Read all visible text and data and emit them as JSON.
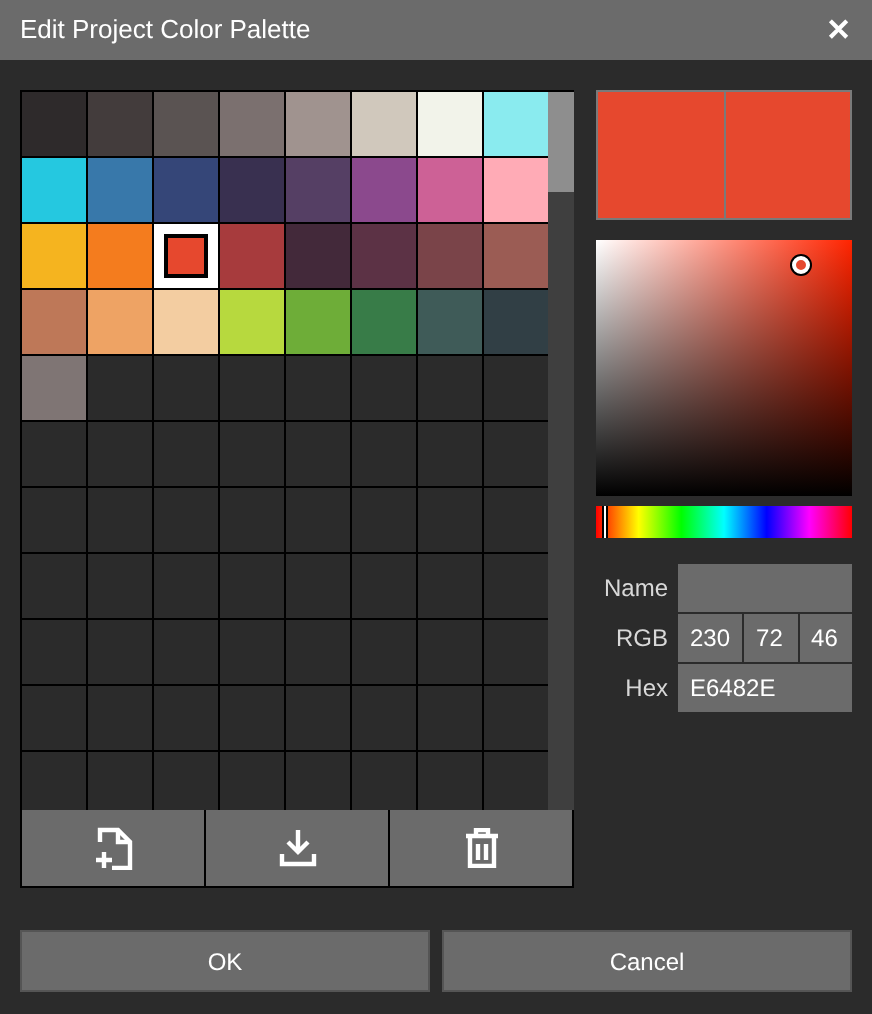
{
  "window": {
    "title": "Edit Project Color Palette",
    "close": "✕"
  },
  "swatches": [
    {
      "color": "#2e2a2b",
      "selected": false
    },
    {
      "color": "#433c3c",
      "selected": false
    },
    {
      "color": "#5a5352",
      "selected": false
    },
    {
      "color": "#7b706f",
      "selected": false
    },
    {
      "color": "#a0938f",
      "selected": false
    },
    {
      "color": "#d0c8bc",
      "selected": false
    },
    {
      "color": "#f2f3ea",
      "selected": false
    },
    {
      "color": "#8aebef",
      "selected": false
    },
    {
      "color": "#25c8e0",
      "selected": false
    },
    {
      "color": "#3878aa",
      "selected": false
    },
    {
      "color": "#354678",
      "selected": false
    },
    {
      "color": "#393050",
      "selected": false
    },
    {
      "color": "#553f64",
      "selected": false
    },
    {
      "color": "#8b498d",
      "selected": false
    },
    {
      "color": "#cd6196",
      "selected": false
    },
    {
      "color": "#ffabb6",
      "selected": false
    },
    {
      "color": "#f5b41f",
      "selected": false
    },
    {
      "color": "#f47c1e",
      "selected": false
    },
    {
      "color": "#e6482e",
      "selected": true
    },
    {
      "color": "#a73b3d",
      "selected": false
    },
    {
      "color": "#43293a",
      "selected": false
    },
    {
      "color": "#5c3245",
      "selected": false
    },
    {
      "color": "#7a4449",
      "selected": false
    },
    {
      "color": "#9b5c54",
      "selected": false
    },
    {
      "color": "#be7858",
      "selected": false
    },
    {
      "color": "#eea364",
      "selected": false
    },
    {
      "color": "#f3cda1",
      "selected": false
    },
    {
      "color": "#b7d93e",
      "selected": false
    },
    {
      "color": "#6ead38",
      "selected": false
    },
    {
      "color": "#387c48",
      "selected": false
    },
    {
      "color": "#3f5b58",
      "selected": false
    },
    {
      "color": "#313f45",
      "selected": false
    },
    {
      "color": "#7f7574",
      "selected": false
    }
  ],
  "editor": {
    "name_label": "Name",
    "rgb_label": "RGB",
    "r": "230",
    "g": "72",
    "b": "46",
    "hex_label": "Hex",
    "hex": "E6482E",
    "hue_slider": {
      "level": 0.02
    }
  },
  "buttons": [
    "OK",
    "Cancel"
  ]
}
